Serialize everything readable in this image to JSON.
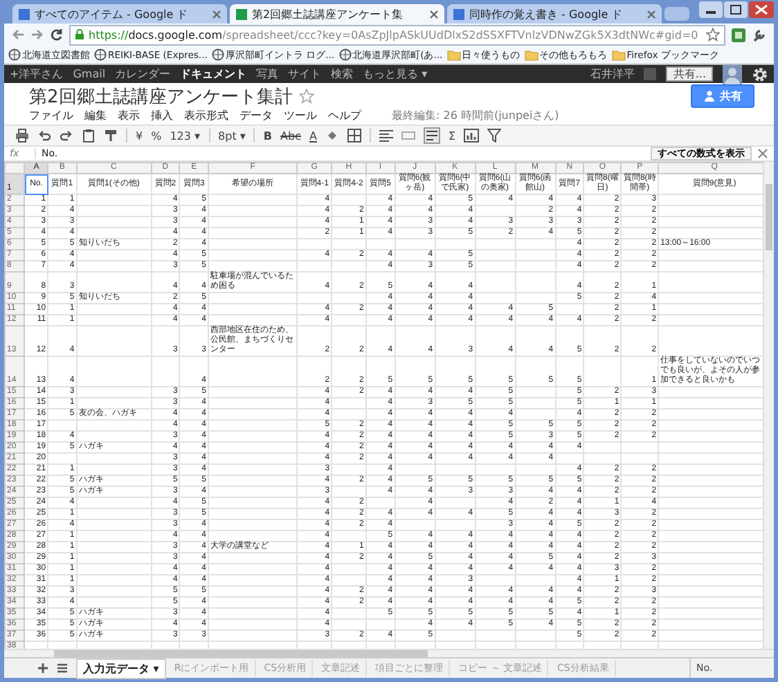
{
  "browser": {
    "tabs": [
      {
        "title": "すべてのアイテム - Google ド",
        "selected": false
      },
      {
        "title": "第2回郷土誌講座アンケート集",
        "selected": true
      },
      {
        "title": "同時作の覚え書き - Google ド",
        "selected": false
      }
    ],
    "url": {
      "scheme": "https://",
      "host": "docs.google.com",
      "path": "/spreadsheet/ccc?key=0AsZpJlpASkUUdDlxS2dSSXFTVnlzVDNwZGk5X3dtNWc#gid=0"
    },
    "bookmarks": [
      {
        "label": "北海道立図書館",
        "kind": "page"
      },
      {
        "label": "REIKI-BASE (Expres...",
        "kind": "page"
      },
      {
        "label": "厚沢部町イントラ ログ...",
        "kind": "page"
      },
      {
        "label": "北海道厚沢部町(あ...",
        "kind": "page"
      },
      {
        "label": "日々使うもの",
        "kind": "folder"
      },
      {
        "label": "その他もろもろ",
        "kind": "folder"
      },
      {
        "label": "Firefox ブックマーク",
        "kind": "folder"
      }
    ]
  },
  "google_bar": {
    "items": [
      {
        "label": "+洋平さん",
        "selected": false
      },
      {
        "label": "Gmail",
        "selected": false
      },
      {
        "label": "カレンダー",
        "selected": false
      },
      {
        "label": "ドキュメント",
        "selected": true
      },
      {
        "label": "写真",
        "selected": false
      },
      {
        "label": "サイト",
        "selected": false
      },
      {
        "label": "検索",
        "selected": false
      },
      {
        "label": "もっと見る ▾",
        "selected": false
      }
    ],
    "user": "石井洋平",
    "share": "共有..."
  },
  "document": {
    "title": "第2回郷土誌講座アンケート集計",
    "share_button": "共有",
    "menu": [
      "ファイル",
      "編集",
      "表示",
      "挿入",
      "表示形式",
      "データ",
      "ツール",
      "ヘルプ"
    ],
    "last_edit": "最終編集: 26 時間前(junpeiさん)"
  },
  "toolbar": {
    "currency": "¥",
    "percent": "%",
    "number_format": "123 ▾",
    "font_size": "8pt ▾",
    "bold": "B",
    "strike": "Abc",
    "text_color": "A",
    "sum": "Σ"
  },
  "formula_bar": {
    "label": "fx",
    "value": "No.",
    "show_all": "すべての数式を表示"
  },
  "sheet": {
    "columns": [
      {
        "letter": "A",
        "kind": "number",
        "selected": true
      },
      {
        "letter": "B",
        "kind": "number",
        "selected": false
      },
      {
        "letter": "C",
        "kind": "text",
        "selected": false
      },
      {
        "letter": "D",
        "kind": "number",
        "selected": false
      },
      {
        "letter": "E",
        "kind": "number",
        "selected": false
      },
      {
        "letter": "F",
        "kind": "text",
        "selected": false
      },
      {
        "letter": "G",
        "kind": "number",
        "selected": false
      },
      {
        "letter": "H",
        "kind": "number",
        "selected": false
      },
      {
        "letter": "I",
        "kind": "number",
        "selected": false
      },
      {
        "letter": "J",
        "kind": "number",
        "selected": false
      },
      {
        "letter": "K",
        "kind": "number",
        "selected": false
      },
      {
        "letter": "L",
        "kind": "number",
        "selected": false
      },
      {
        "letter": "M",
        "kind": "number",
        "selected": false
      },
      {
        "letter": "N",
        "kind": "number",
        "selected": false
      },
      {
        "letter": "O",
        "kind": "number",
        "selected": false
      },
      {
        "letter": "P",
        "kind": "number",
        "selected": false
      },
      {
        "letter": "Q",
        "kind": "text",
        "selected": false
      }
    ],
    "header_row": {
      "number": "1",
      "selected": true,
      "cells": [
        "No.",
        "質問1",
        "質問1(その他)",
        "質問2",
        "質問3",
        "希望の場所",
        "質問4-1",
        "質問4-2",
        "質問5",
        "質問6(観ヶ岳)",
        "質問6(中で氏家)",
        "質問6(山の奥家)",
        "質問6(函館山)",
        "質問7",
        "質問8(曜日)",
        "質問8(時間帯)",
        "質問9(意見)"
      ]
    },
    "rows": [
      {
        "number": "2",
        "cells": [
          "1",
          "1",
          null,
          "4",
          "5",
          null,
          "4",
          null,
          "4",
          "4",
          "5",
          "4",
          "4",
          "4",
          "2",
          "3",
          null
        ]
      },
      {
        "number": "3",
        "cells": [
          "2",
          "4",
          null,
          "3",
          "4",
          null,
          "4",
          "2",
          "4",
          "4",
          "4",
          null,
          "2",
          "4",
          "2",
          "2",
          null
        ]
      },
      {
        "number": "4",
        "cells": [
          "3",
          "3",
          null,
          "3",
          "4",
          null,
          "4",
          "1",
          "4",
          "3",
          "4",
          "3",
          "3",
          "3",
          "2",
          "2",
          null
        ]
      },
      {
        "number": "5",
        "cells": [
          "4",
          "4",
          null,
          "4",
          "4",
          null,
          "2",
          "1",
          "4",
          "3",
          "5",
          "2",
          "4",
          "5",
          "2",
          "2",
          null
        ]
      },
      {
        "number": "6",
        "cells": [
          "5",
          "5",
          "知りいだち",
          "2",
          "4",
          null,
          null,
          null,
          null,
          null,
          null,
          null,
          null,
          "4",
          "2",
          "2",
          "13:00～16:00"
        ]
      },
      {
        "number": "7",
        "cells": [
          "6",
          "4",
          null,
          "4",
          "5",
          null,
          "4",
          "2",
          "4",
          "4",
          "5",
          null,
          null,
          "4",
          "2",
          "2",
          null
        ]
      },
      {
        "number": "8",
        "cells": [
          "7",
          "4",
          null,
          "3",
          "5",
          null,
          null,
          null,
          "4",
          "3",
          "5",
          null,
          null,
          "4",
          "2",
          "2",
          null
        ]
      },
      {
        "number": "9",
        "cells": [
          "8",
          "3",
          null,
          "4",
          "4",
          "駐車場が混んでいるため困る",
          "4",
          "2",
          "5",
          "4",
          "4",
          null,
          null,
          "4",
          "2",
          "1",
          null
        ]
      },
      {
        "number": "10",
        "cells": [
          "9",
          "5",
          "知りいだち",
          "2",
          "5",
          null,
          null,
          null,
          "4",
          "4",
          "4",
          null,
          null,
          "5",
          "2",
          "4",
          null
        ]
      },
      {
        "number": "11",
        "cells": [
          "10",
          "1",
          null,
          "4",
          "4",
          null,
          "4",
          "2",
          "4",
          "4",
          "4",
          "4",
          "5",
          null,
          "2",
          "1",
          null
        ]
      },
      {
        "number": "12",
        "cells": [
          "11",
          "1",
          null,
          "4",
          "4",
          null,
          "4",
          null,
          "4",
          "4",
          "4",
          "4",
          "4",
          "4",
          "2",
          "2",
          null
        ]
      },
      {
        "number": "13",
        "cells": [
          "12",
          "4",
          null,
          "3",
          "3",
          "西部地区在住のため、公民館、まちづくりセンター",
          "2",
          "2",
          "4",
          "4",
          "3",
          "4",
          "4",
          "5",
          "2",
          "2",
          null
        ]
      },
      {
        "number": "14",
        "cells": [
          "13",
          "4",
          null,
          null,
          "4",
          null,
          "2",
          "2",
          "5",
          "5",
          "5",
          "5",
          "5",
          "5",
          null,
          "1",
          "仕事をしていないのでいつでも良いが、よその人が参加できると良いかも"
        ]
      },
      {
        "number": "15",
        "cells": [
          "14",
          "3",
          null,
          "3",
          "5",
          null,
          "4",
          "2",
          "4",
          "4",
          "4",
          "5",
          null,
          "5",
          "2",
          "3",
          null
        ]
      },
      {
        "number": "16",
        "cells": [
          "15",
          "1",
          null,
          "3",
          "4",
          null,
          "4",
          null,
          "4",
          "3",
          "5",
          "5",
          null,
          "5",
          "1",
          "1",
          null
        ]
      },
      {
        "number": "17",
        "cells": [
          "16",
          "5",
          "友の会、ハガキ",
          "4",
          "4",
          null,
          "4",
          null,
          "4",
          "4",
          "4",
          "4",
          null,
          "4",
          "2",
          "2",
          null
        ]
      },
      {
        "number": "18",
        "cells": [
          "17",
          null,
          null,
          "4",
          "4",
          null,
          "5",
          "2",
          "4",
          "4",
          "4",
          "5",
          "5",
          "5",
          "2",
          "2",
          null
        ]
      },
      {
        "number": "19",
        "cells": [
          "18",
          "4",
          null,
          "3",
          "4",
          null,
          "4",
          "2",
          "4",
          "4",
          "4",
          "5",
          "3",
          "5",
          "2",
          "2",
          null
        ]
      },
      {
        "number": "20",
        "cells": [
          "19",
          "5",
          "ハガキ",
          "4",
          "4",
          null,
          "4",
          "2",
          "4",
          "4",
          "4",
          "4",
          "4",
          "4",
          null,
          null,
          null
        ]
      },
      {
        "number": "21",
        "cells": [
          "20",
          null,
          null,
          "3",
          "4",
          null,
          "4",
          "2",
          "4",
          "4",
          "4",
          "4",
          "4",
          null,
          null,
          null,
          null
        ]
      },
      {
        "number": "22",
        "cells": [
          "21",
          "1",
          null,
          "3",
          "4",
          null,
          "3",
          null,
          "4",
          null,
          null,
          null,
          null,
          "4",
          "2",
          "2",
          null
        ]
      },
      {
        "number": "23",
        "cells": [
          "22",
          "5",
          "ハガキ",
          "5",
          "5",
          null,
          "4",
          "2",
          "4",
          "5",
          "5",
          "5",
          "5",
          "5",
          "2",
          "2",
          null
        ]
      },
      {
        "number": "24",
        "cells": [
          "23",
          "5",
          "ハガキ",
          "3",
          "4",
          null,
          "3",
          null,
          "4",
          "4",
          "3",
          "3",
          "4",
          "4",
          "2",
          "2",
          null
        ]
      },
      {
        "number": "25",
        "cells": [
          "24",
          "4",
          null,
          "4",
          "5",
          null,
          "4",
          "2",
          null,
          "4",
          null,
          "4",
          "2",
          "4",
          "1",
          "4",
          null
        ]
      },
      {
        "number": "26",
        "cells": [
          "25",
          "1",
          null,
          "3",
          "5",
          null,
          "4",
          "2",
          "4",
          "4",
          "4",
          "5",
          "4",
          "4",
          "3",
          "2",
          null
        ]
      },
      {
        "number": "27",
        "cells": [
          "26",
          "4",
          null,
          "3",
          "4",
          null,
          "4",
          "2",
          "4",
          null,
          null,
          "3",
          "4",
          "5",
          "2",
          "2",
          null
        ]
      },
      {
        "number": "28",
        "cells": [
          "27",
          "1",
          null,
          "4",
          "4",
          null,
          "4",
          null,
          "5",
          "4",
          "4",
          "4",
          "4",
          "4",
          "2",
          "2",
          null
        ]
      },
      {
        "number": "29",
        "cells": [
          "28",
          "1",
          null,
          "3",
          "4",
          "大学の講堂など",
          "4",
          "1",
          "4",
          "4",
          "4",
          "4",
          "4",
          "4",
          "2",
          "2",
          null
        ]
      },
      {
        "number": "30",
        "cells": [
          "29",
          "1",
          null,
          "3",
          "4",
          null,
          "4",
          "2",
          "4",
          "5",
          "4",
          "4",
          "5",
          "4",
          "2",
          "3",
          null
        ]
      },
      {
        "number": "31",
        "cells": [
          "30",
          "1",
          null,
          "4",
          "4",
          null,
          "4",
          null,
          "4",
          "4",
          "4",
          "4",
          "4",
          "4",
          "3",
          "2",
          null
        ]
      },
      {
        "number": "32",
        "cells": [
          "31",
          "1",
          null,
          "4",
          "4",
          null,
          "4",
          null,
          "4",
          "4",
          "3",
          null,
          null,
          "4",
          "1",
          "2",
          null
        ]
      },
      {
        "number": "33",
        "cells": [
          "32",
          "3",
          null,
          "5",
          "5",
          null,
          "4",
          "2",
          "4",
          "4",
          "4",
          "4",
          "4",
          "4",
          "2",
          "3",
          null
        ]
      },
      {
        "number": "34",
        "cells": [
          "33",
          "4",
          null,
          "5",
          "4",
          null,
          "4",
          "2",
          "4",
          "4",
          "4",
          "4",
          "4",
          "5",
          "2",
          "2",
          null
        ]
      },
      {
        "number": "35",
        "cells": [
          "34",
          "5",
          "ハガキ",
          "3",
          "4",
          null,
          "4",
          null,
          "5",
          "5",
          "5",
          "5",
          "5",
          "4",
          "1",
          "2",
          null
        ]
      },
      {
        "number": "36",
        "cells": [
          "35",
          "5",
          "ハガキ",
          "4",
          "4",
          null,
          "4",
          null,
          null,
          "4",
          "4",
          "5",
          "4",
          "5",
          "2",
          "2",
          null
        ]
      },
      {
        "number": "37",
        "cells": [
          "36",
          "5",
          "ハガキ",
          "3",
          "3",
          null,
          "3",
          "2",
          "4",
          "5",
          null,
          null,
          null,
          "5",
          "2",
          "2",
          null
        ]
      },
      {
        "number": "38",
        "cells": []
      }
    ]
  },
  "sheet_tabs": [
    {
      "label": "入力元データ ▾",
      "selected": true
    },
    {
      "label": "Rにインポート用",
      "selected": false
    },
    {
      "label": "CS分析用",
      "selected": false
    },
    {
      "label": "文章記述",
      "selected": false
    },
    {
      "label": "項目ごとに整理",
      "selected": false
    },
    {
      "label": "コピー ～ 文章記述",
      "selected": false
    },
    {
      "label": "CS分析結果",
      "selected": false
    }
  ],
  "status": "No."
}
